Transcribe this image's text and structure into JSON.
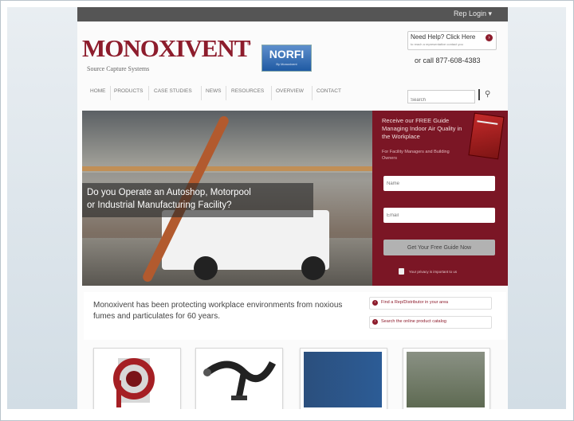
{
  "topbar": {
    "login_label": "Rep Login ▾"
  },
  "header": {
    "logo_text": "MONOXIVENT",
    "logo_mark": "®",
    "tagline": "Source Capture Systems",
    "norfi_logo": "NORFI",
    "norfi_sub": "By Monoxivent",
    "help_title": "Need Help? Click Here",
    "help_subtitle": "to reach a representative contact you",
    "phone": "or call 877-608-4383"
  },
  "nav": {
    "items": [
      "HOME",
      "PRODUCTS",
      "CASE STUDIES",
      "NEWS",
      "RESOURCES",
      "OVERVIEW",
      "CONTACT"
    ],
    "search_placeholder": "Search"
  },
  "hero": {
    "caption_line1": "Do you Operate an Autoshop, Motorpool",
    "caption_line2": "or Industrial Manufacturing Facility?"
  },
  "guide_form": {
    "heading": "Receive our FREE Guide Managing Indoor Air Quality in the Workplace",
    "subheading": "For Facility Managers and Building Owners",
    "name_placeholder": "Name",
    "email_placeholder": "Email",
    "submit_label": "Get Your Free Guide Now",
    "privacy_text": "Your privacy is important to us"
  },
  "intro": {
    "text": "Monoxivent has been protecting workplace environments from noxious fumes and particulates for 60 years.",
    "cta1": "Find a Rep/Distributor in your area",
    "cta2": "Search the online product catalog"
  },
  "colors": {
    "brand": "#8d1c2c",
    "topbar": "#555555",
    "guide_bg": "#7b1625"
  }
}
